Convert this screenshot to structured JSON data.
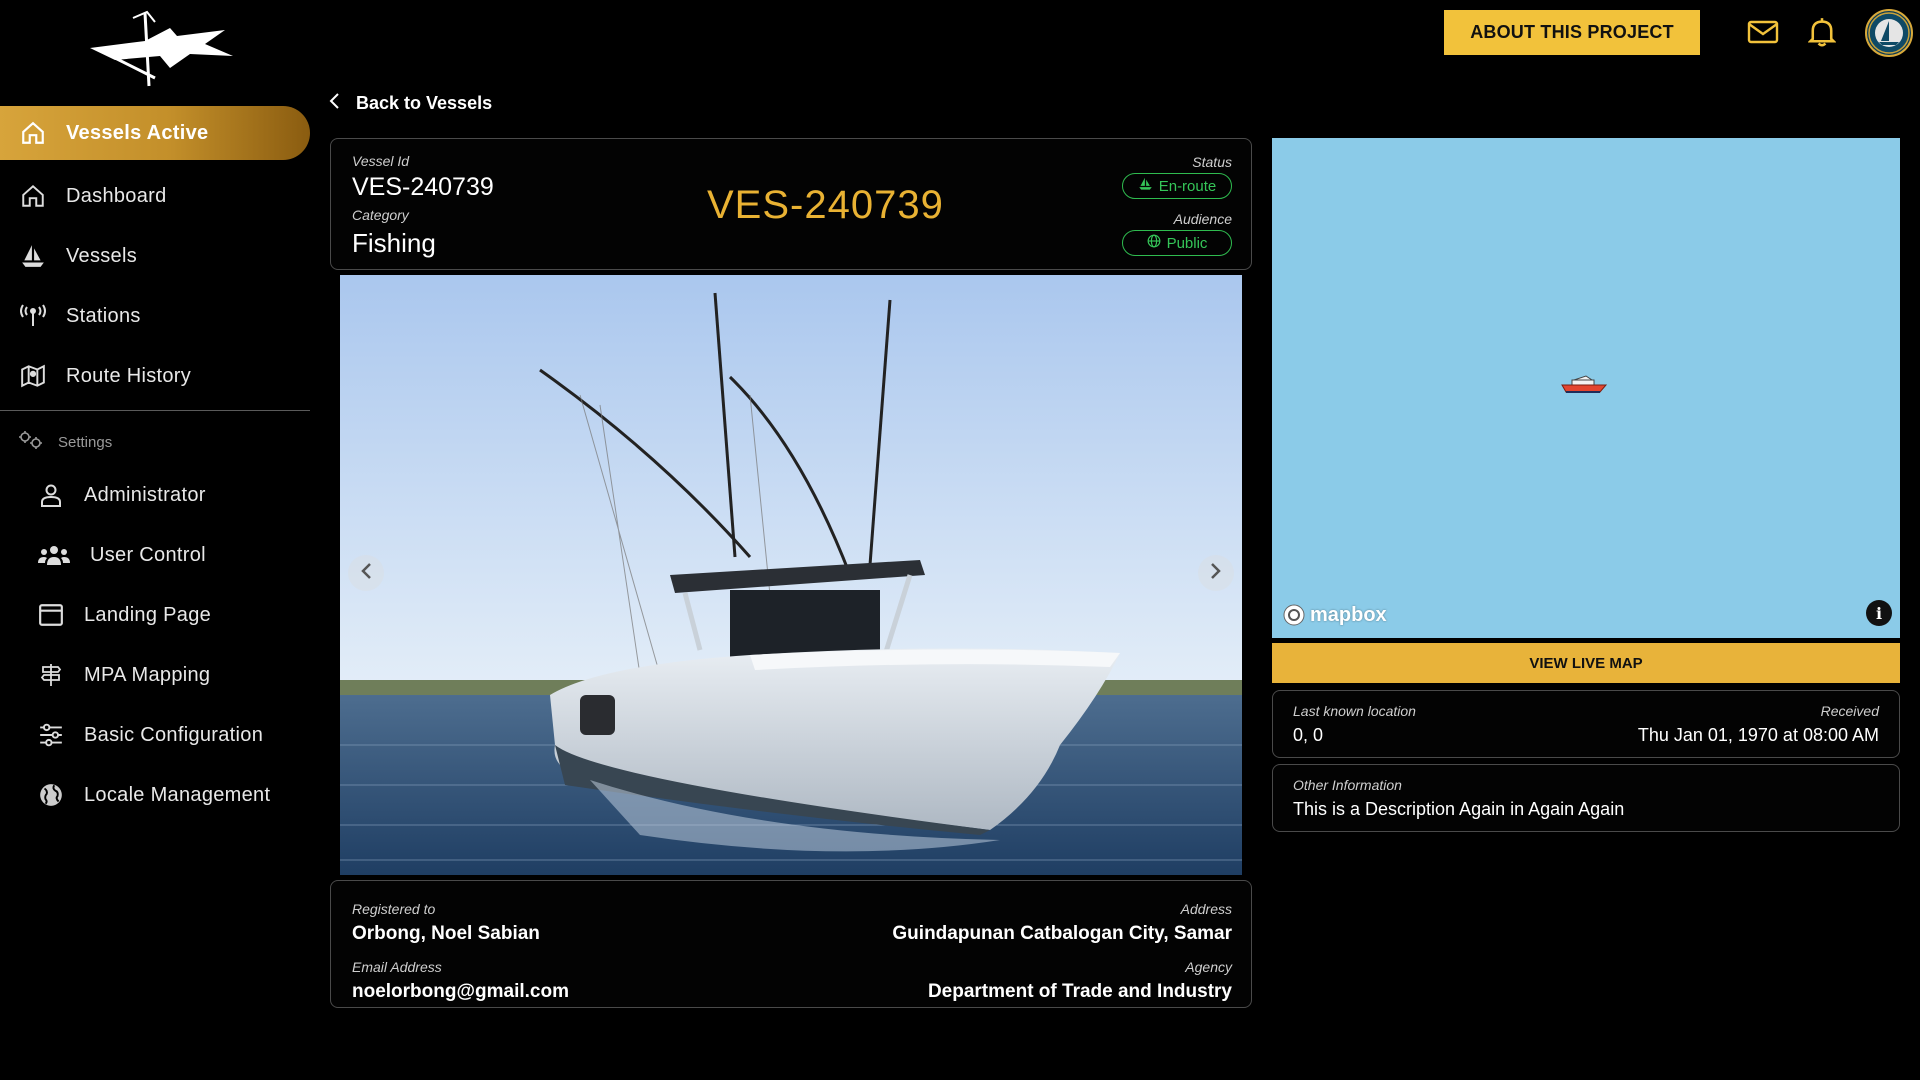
{
  "sidebar": {
    "active_item": "Vessels Active",
    "items": [
      {
        "label": "Dashboard",
        "icon": "home-icon"
      },
      {
        "label": "Vessels",
        "icon": "sailboat-icon"
      },
      {
        "label": "Stations",
        "icon": "antenna-icon"
      },
      {
        "label": "Route History",
        "icon": "map-icon"
      }
    ],
    "settings_label": "Settings",
    "settings_items": [
      {
        "label": "Administrator",
        "icon": "user-icon"
      },
      {
        "label": "User Control",
        "icon": "users-icon"
      },
      {
        "label": "Landing Page",
        "icon": "window-icon"
      },
      {
        "label": "MPA Mapping",
        "icon": "signpost-icon"
      },
      {
        "label": "Basic Configuration",
        "icon": "sliders-icon"
      },
      {
        "label": "Locale Management",
        "icon": "globe-icon"
      }
    ]
  },
  "header": {
    "about_label": "ABOUT THIS PROJECT"
  },
  "back_label": "Back to Vessels",
  "vessel": {
    "id_label": "Vessel Id",
    "id": "VES-240739",
    "category_label": "Category",
    "category": "Fishing",
    "big_id": "VES-240739",
    "status_label": "Status",
    "status": "En-route",
    "audience_label": "Audience",
    "audience": "Public"
  },
  "registration": {
    "registered_label": "Registered to",
    "registered": "Orbong, Noel Sabian",
    "address_label": "Address",
    "address": "Guindapunan Catbalogan City, Samar",
    "email_label": "Email Address",
    "email": "noelorbong@gmail.com",
    "agency_label": "Agency",
    "agency": "Department of Trade and Industry"
  },
  "map": {
    "brand": "mapbox",
    "info_glyph": "i",
    "live_label": "VIEW LIVE MAP"
  },
  "location": {
    "last_label": "Last known location",
    "last_value": "0, 0",
    "received_label": "Received",
    "received_value": "Thu Jan 01, 1970 at 08:00 AM"
  },
  "other": {
    "label": "Other Information",
    "value": "This is a Description Again in Again Again"
  },
  "colors": {
    "accent": "#f2c23b",
    "status_green": "#2fbb4f",
    "id_gold": "#e9b233",
    "map_water": "#8bcbe8"
  }
}
